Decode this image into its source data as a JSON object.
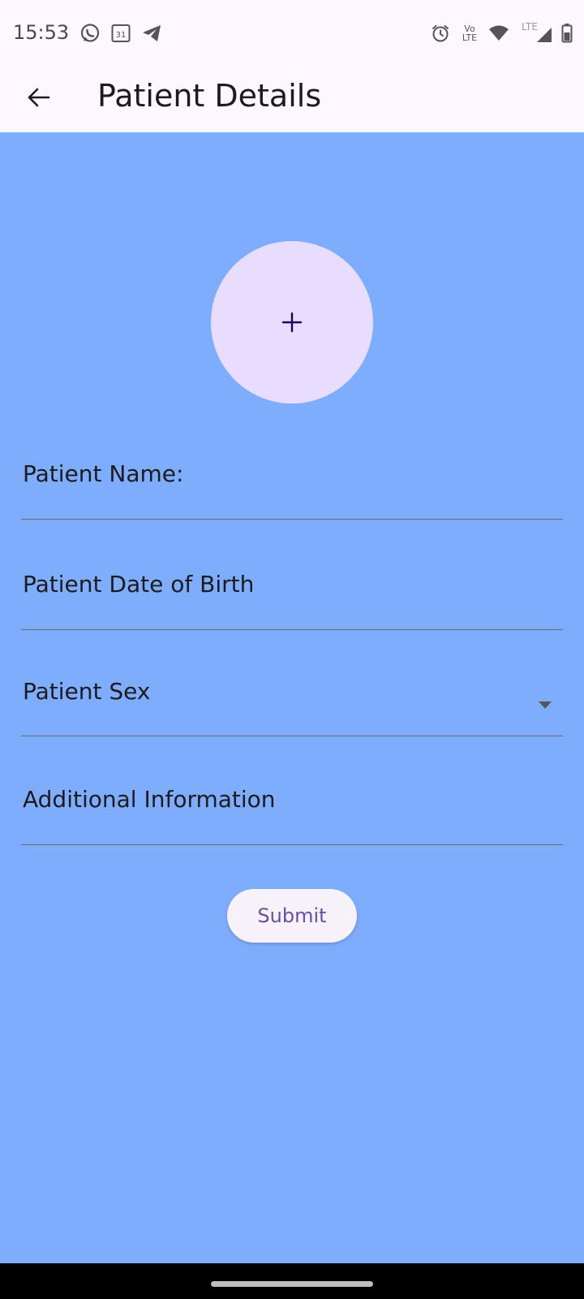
{
  "status_bar": {
    "time": "15:53",
    "left_icons": [
      "whatsapp-icon",
      "calendar-icon",
      "telegram-icon"
    ],
    "calendar_day": "31",
    "right_icons": [
      "alarm-icon",
      "volte-icon",
      "wifi-icon",
      "lte-signal-icon",
      "battery-icon"
    ],
    "volte_top": "Vo",
    "volte_bottom": "LTE",
    "lte_label": "LTE"
  },
  "app_bar": {
    "title": "Patient Details",
    "back_icon": "arrow-back-icon"
  },
  "form": {
    "avatar_symbol": "+",
    "fields": [
      {
        "label": "Patient Name:"
      },
      {
        "label": "Patient Date of Birth"
      },
      {
        "label": "Patient Sex"
      },
      {
        "label": "Additional Information"
      }
    ],
    "submit_label": "Submit"
  },
  "colors": {
    "background": "#7fadfd",
    "app_bar": "#fdf7ff",
    "avatar": "#e9ddff",
    "accent": "#6750a4"
  }
}
